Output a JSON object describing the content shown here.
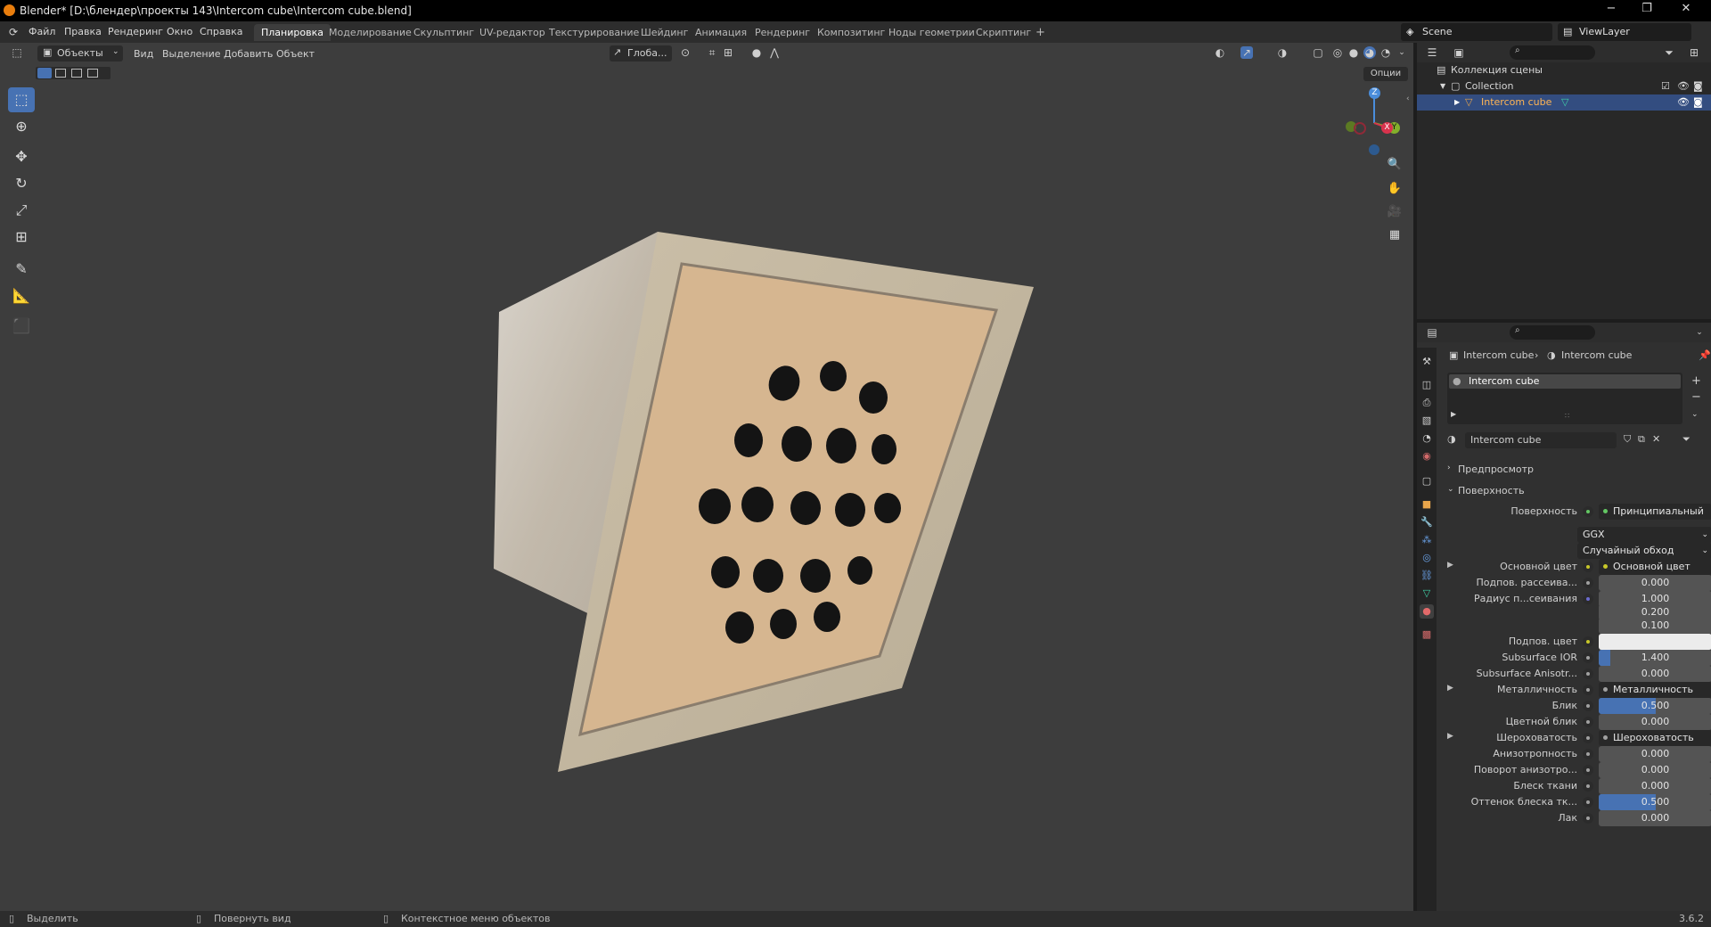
{
  "window": {
    "title": "Blender* [D:\\блендер\\проекты 143\\Intercom cube\\Intercom cube.blend]",
    "minimize": "−",
    "maximize": "❐",
    "close": "✕"
  },
  "menu": {
    "items": [
      "Файл",
      "Правка",
      "Рендеринг",
      "Окно",
      "Справка"
    ],
    "workspaces": [
      "Планировка",
      "Моделирование",
      "Скульптинг",
      "UV-редактор",
      "Текстурирование",
      "Шейдинг",
      "Анимация",
      "Рендеринг",
      "Композитинг",
      "Ноды геометрии",
      "Скриптинг"
    ],
    "active_workspace": "Планировка",
    "add_workspace": "+",
    "scene": "Scene",
    "view_layer": "ViewLayer"
  },
  "viewport_header": {
    "mode": "Объекты",
    "view": "Вид",
    "select": "Выделение",
    "add": "Добавить",
    "object": "Объект",
    "orientation": "Глоба...",
    "options": "Опции"
  },
  "gizmo": {
    "z": "Z",
    "y": "Y",
    "x": "X"
  },
  "outliner": {
    "scene_collection": "Коллекция сцены",
    "collection": "Collection",
    "object": "Intercom cube"
  },
  "properties": {
    "breadcrumb_object": "Intercom cube",
    "breadcrumb_material": "Intercom cube",
    "slot": "Intercom cube",
    "material_name": "Intercom cube",
    "preview": "Предпросмотр",
    "surface_panel": "Поверхность",
    "rows": [
      {
        "label": "Поверхность",
        "value": "Принципиальный BSDF",
        "kind": "link",
        "dot": "green"
      },
      {
        "label": "",
        "value": "GGX",
        "kind": "dropdown"
      },
      {
        "label": "",
        "value": "Случайный обход",
        "kind": "dropdown"
      },
      {
        "label": "Основной цвет",
        "value": "Основной цвет",
        "kind": "link",
        "dot": "yellow",
        "expand": true
      },
      {
        "label": "Подпов. рассеива...",
        "value": "0.000",
        "kind": "number",
        "dot": "gray",
        "fill": 0
      },
      {
        "label": "Радиус п...сеивания",
        "value": "1.000",
        "kind": "number",
        "dot": "blue",
        "fill": 0
      },
      {
        "label": "",
        "value": "0.200",
        "kind": "number",
        "fill": 0
      },
      {
        "label": "",
        "value": "0.100",
        "kind": "number",
        "fill": 0
      },
      {
        "label": "Подпов. цвет",
        "value": "",
        "kind": "color",
        "dot": "yellow",
        "color": "#ececec"
      },
      {
        "label": "Subsurface IOR",
        "value": "1.400",
        "kind": "number",
        "dot": "gray",
        "fill": 0.1
      },
      {
        "label": "Subsurface Anisotr...",
        "value": "0.000",
        "kind": "number",
        "dot": "gray",
        "fill": 0
      },
      {
        "label": "Металличность",
        "value": "Металличность",
        "kind": "link",
        "dot": "gray",
        "expand": true
      },
      {
        "label": "Блик",
        "value": "0.500",
        "kind": "number",
        "dot": "gray",
        "fill": 0.5
      },
      {
        "label": "Цветной блик",
        "value": "0.000",
        "kind": "number",
        "dot": "gray",
        "fill": 0
      },
      {
        "label": "Шероховатость",
        "value": "Шероховатость",
        "kind": "link",
        "dot": "gray",
        "expand": true
      },
      {
        "label": "Анизотропность",
        "value": "0.000",
        "kind": "number",
        "dot": "gray",
        "fill": 0
      },
      {
        "label": "Поворот анизотро...",
        "value": "0.000",
        "kind": "number",
        "dot": "gray",
        "fill": 0
      },
      {
        "label": "Блеск ткани",
        "value": "0.000",
        "kind": "number",
        "dot": "gray",
        "fill": 0
      },
      {
        "label": "Оттенок блеска тк...",
        "value": "0.500",
        "kind": "number",
        "dot": "gray",
        "fill": 0.5
      },
      {
        "label": "Лак",
        "value": "0.000",
        "kind": "number",
        "dot": "gray",
        "fill": 0
      }
    ]
  },
  "statusbar": {
    "select": "Выделить",
    "rotate": "Повернуть вид",
    "context": "Контекстное меню объектов",
    "version": "3.6.2"
  },
  "colors": {
    "accent": "#4772b3",
    "viewport_bg": "#3d3d3d",
    "selected_row": "#334d80",
    "object_face": "#d9b991",
    "holes": "#141414"
  }
}
